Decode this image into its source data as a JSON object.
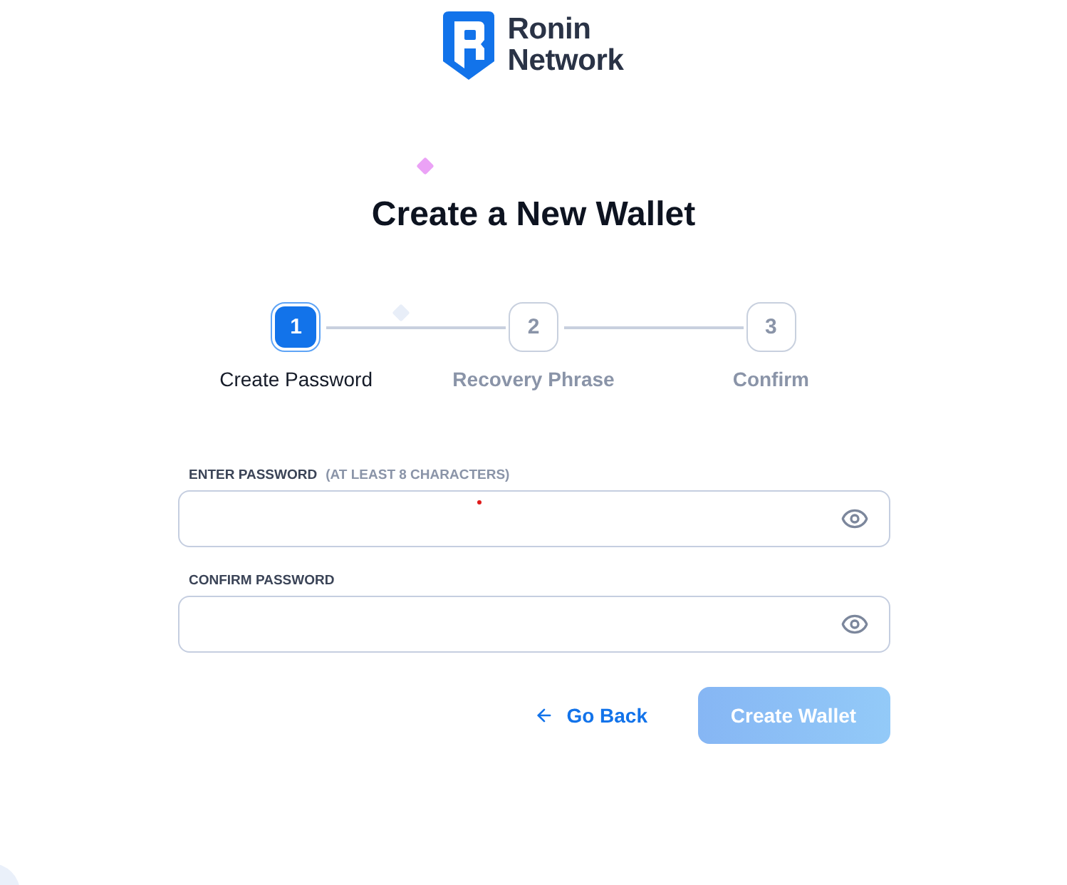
{
  "logo": {
    "line_1": "Ronin",
    "line_2": "Network"
  },
  "title": "Create a New Wallet",
  "steps": [
    {
      "number": "1",
      "label": "Create Password",
      "selected": true
    },
    {
      "number": "2",
      "label": "Recovery Phrase",
      "selected": false
    },
    {
      "number": "3",
      "label": "Confirm",
      "selected": false
    }
  ],
  "fields": [
    {
      "label": "ENTER PASSWORD",
      "hint": "(AT LEAST 8 CHARACTERS)"
    },
    {
      "label": "CONFIRM PASSWORD"
    }
  ],
  "buttons": [
    {
      "kind": "link",
      "label": "Go Back",
      "disabled": false
    },
    {
      "kind": "primary",
      "label": "Create Wallet",
      "disabled": true
    }
  ]
}
